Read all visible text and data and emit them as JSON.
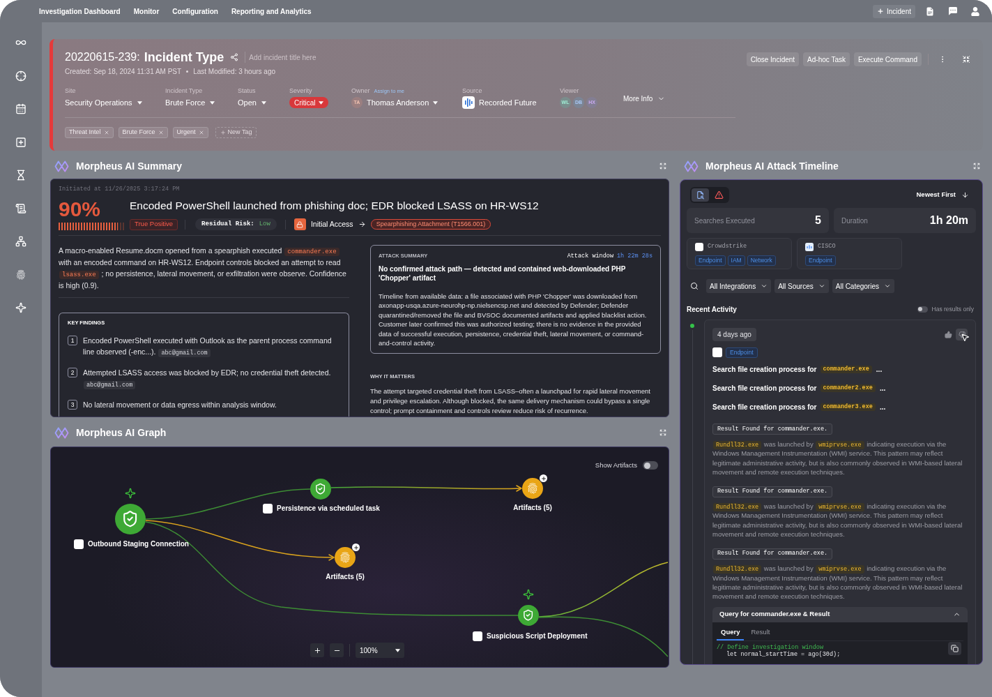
{
  "top_nav": {
    "items": [
      "Investigation Dashboard",
      "Monitor",
      "Configuration",
      "Reporting and Analytics"
    ],
    "new_incident": "Incident"
  },
  "incident": {
    "id": "20220615-239:",
    "type": "Incident Type",
    "title_placeholder": "Add incident title here",
    "created": "Created: Sep 18, 2024 11:31 AM PST",
    "modified": "Last Modified: 3 hours ago",
    "fields": [
      {
        "kind": "dropdown",
        "label": "Site",
        "value": "Security Operations"
      },
      {
        "kind": "dropdown",
        "label": "Incident Type",
        "value": "Brute Force"
      },
      {
        "kind": "dropdown",
        "label": "Status",
        "value": "Open"
      },
      {
        "kind": "severity",
        "label": "Severity",
        "value": "Critical"
      },
      {
        "kind": "owner",
        "label": "Owner",
        "link": "Assign to me",
        "initials": "TA",
        "value": "Thomas Anderson"
      },
      {
        "kind": "source",
        "label": "Source",
        "value": "Recorded Future"
      },
      {
        "kind": "viewers",
        "label": "Viewer",
        "viewers": [
          {
            "initials": "WL",
            "color": "#9ff0d6"
          },
          {
            "initials": "DB",
            "color": "#a9c9f7"
          },
          {
            "initials": "HX",
            "color": "#c9a9f0"
          }
        ]
      }
    ],
    "more_info": "More Info",
    "tags": [
      "Threat Intel",
      "Brute Force",
      "Urgent"
    ],
    "new_tag": "New Tag",
    "actions": [
      "Close Incident",
      "Ad-hoc Task",
      "Execute Command"
    ]
  },
  "summary": {
    "title": "Morpheus AI Summary",
    "initiated": "Initiated at 11/26/2025 3:17:24 PM",
    "confidence": "90%",
    "confidence_meter": {
      "level": 0.9
    },
    "headline": "Encoded PowerShell launched from phishing doc; EDR blocked LSASS on HR-WS12",
    "verdict": "True Positive",
    "residual_risk_label": "Residual Risk:",
    "residual_risk": "Low",
    "tactic": "Initial Access",
    "technique": "Spearphishing Attachment (T1566.001)",
    "overview": [
      {
        "kind": "text",
        "text": "A macro-enabled Resume.docm opened from a spearphish executed"
      },
      {
        "kind": "code",
        "text": "commander.exe"
      },
      {
        "kind": "text",
        "text": "with an encoded command on HR-WS12. Endpoint controls blocked an attempt to read"
      },
      {
        "kind": "code",
        "text": "lsass.exe"
      },
      {
        "kind": "text",
        "text": "; no persistence, lateral movement, or exfiltration were observe. Confidence is high (0.9)."
      }
    ],
    "key_findings": {
      "title": "KEY FINDINGS",
      "items": [
        {
          "number": "1",
          "body": [
            {
              "kind": "text",
              "text": "Encoded PowerShell executed with Outlook as the parent process command line observed (-enc...)."
            },
            {
              "kind": "code",
              "text": "abc@gmail.com"
            }
          ]
        },
        {
          "number": "2",
          "body": [
            {
              "kind": "text",
              "text": "Attempted LSASS access was blocked by EDR; no credential theft detected."
            },
            {
              "kind": "code",
              "text": "abc@gmail.com"
            }
          ]
        },
        {
          "number": "3",
          "body": [
            {
              "kind": "text",
              "text": "No lateral movement or data egress within analysis window."
            }
          ]
        }
      ]
    },
    "attack_summary": {
      "title": "ATTACK SUMMARY",
      "window_label": "Attack window",
      "window": "1h 22m 28s",
      "heading": "No confirmed attack path — detected and contained web-downloaded PHP 'Chopper' artifact",
      "text": "Timeline from available data: a file associated with PHP 'Chopper' was downloaded from axonapp-usqa.azure-neurohp-np.nielsencsp.net and detected by Defender; Defender quarantined/removed the file and BVSOC documented artifacts and applied blacklist action. Customer later confirmed this was authorized testing; there is no evidence in the provided data of successful execution, persistence, credential theft, lateral movement, or command-and-control activity."
    },
    "why_it_matters": {
      "title": "WHY IT MATTERS",
      "text": "The attempt targeted credential theft from LSASS–often a launchpad for rapid lateral movement and privilege escalation. Although blocked, the same delivery mechanism could bypass a single control; prompt containment and controls review reduce risk of recurrence."
    }
  },
  "graph": {
    "title": "Morpheus AI Graph",
    "show_artifacts": {
      "label": "Show Artifacts",
      "on": false
    },
    "nodes": [
      {
        "kind": "event",
        "label": "Outbound Staging Connection",
        "flagged": true
      },
      {
        "kind": "event",
        "label": "Persistence via scheduled task",
        "flagged": false
      },
      {
        "kind": "artifact",
        "label": "Artifacts (5)"
      },
      {
        "kind": "artifact",
        "label": "Artifacts (5)"
      },
      {
        "kind": "event",
        "label": "Suspicious Script Deployment",
        "flagged": true
      }
    ],
    "zoom": "100%"
  },
  "timeline": {
    "title": "Morpheus AI Attack Timeline",
    "view_tabs": [
      {
        "kind": "searches",
        "selected": true
      },
      {
        "kind": "alerts",
        "selected": false
      }
    ],
    "sort": "Newest First",
    "stats": [
      {
        "label": "Searches Executed",
        "value": "5"
      },
      {
        "label": "Duration",
        "value": "1h 20m"
      }
    ],
    "integrations": [
      {
        "kind": "blank",
        "name": "Crowdstrike",
        "tags": [
          "Endpoint",
          "IAM",
          "Network"
        ]
      },
      {
        "kind": "bars",
        "name": "CISCO",
        "tags": [
          "Endpoint"
        ]
      }
    ],
    "filters": [
      "All Integrations",
      "All Sources",
      "All Categories"
    ],
    "recent_activity": "Recent Activity",
    "has_results_only": {
      "label": "Has results only",
      "on": false
    },
    "entries": [
      {
        "time": "4 days ago",
        "tag": "Endpoint",
        "searches": [
          {
            "text": "Search file creation process for",
            "code": "commander.exe",
            "more": "..."
          },
          {
            "text": "Search file creation process for",
            "code": "commander2.exe",
            "more": "..."
          },
          {
            "text": "Search file creation process for",
            "code": "commander3.exe",
            "more": "..."
          }
        ],
        "results": [
          {
            "title": "Result Found for commander.exe.",
            "body": [
              {
                "kind": "code",
                "text": "Rundll32.exe"
              },
              {
                "kind": "text",
                "text": "was launched by"
              },
              {
                "kind": "code",
                "text": "wmiprvse.exe"
              },
              {
                "kind": "text",
                "text": "indicating execution via the Windows Management Instrumentation (WMI) service. This pattern may reflect legitimate administrative activity, but is also commonly observed in WMI-based lateral movement and remote execution techniques."
              }
            ]
          },
          {
            "title": "Result Found for commander.exe.",
            "body": [
              {
                "kind": "code",
                "text": "Rundll32.exe"
              },
              {
                "kind": "text",
                "text": "was launched by"
              },
              {
                "kind": "code",
                "text": "wmiprvse.exe"
              },
              {
                "kind": "text",
                "text": "indicating execution via the Windows Management Instrumentation (WMI) service. This pattern may reflect legitimate administrative activity, but is also commonly observed in WMI-based lateral movement and remote execution techniques."
              }
            ]
          },
          {
            "title": "Result Found for commander.exe.",
            "body": [
              {
                "kind": "code",
                "text": "Rundll32.exe"
              },
              {
                "kind": "text",
                "text": "was launched by"
              },
              {
                "kind": "code",
                "text": "wmiprvse.exe"
              },
              {
                "kind": "text",
                "text": "indicating execution via the Windows Management Instrumentation (WMI) service. This pattern may reflect legitimate administrative activity, but is also commonly observed in WMI-based lateral movement and remote execution techniques."
              }
            ]
          }
        ],
        "query": {
          "title": "Query for commander.exe & Result",
          "expanded": true,
          "tabs": [
            {
              "label": "Query",
              "selected": true
            },
            {
              "label": "Result",
              "selected": false
            }
          ],
          "code": [
            {
              "kind": "comment",
              "text": "// Define investigation window"
            },
            {
              "kind": "statement",
              "text": "let normal_startTime = ago(30d);"
            }
          ]
        }
      }
    ]
  }
}
